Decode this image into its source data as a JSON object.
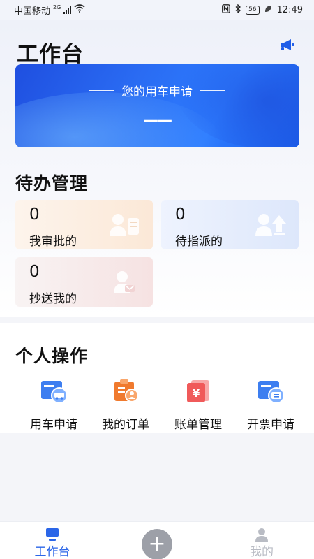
{
  "status_bar": {
    "carrier": "中国移动",
    "network": "2G",
    "battery": "56",
    "time": "12:49",
    "icons": [
      "signal-icon",
      "wifi-icon",
      "nfc-icon",
      "bluetooth-icon",
      "battery-icon",
      "leaf-icon"
    ]
  },
  "header": {
    "title": "工作台",
    "notice_icon": "megaphone-icon"
  },
  "banner": {
    "title": "您的用车申请",
    "value": "——"
  },
  "todo": {
    "title": "待办管理",
    "cards": [
      {
        "count": "0",
        "label": "我审批的",
        "icon": "approve-icon"
      },
      {
        "count": "0",
        "label": "待指派的",
        "icon": "assign-icon"
      },
      {
        "count": "0",
        "label": "抄送我的",
        "icon": "cc-icon"
      }
    ]
  },
  "personal": {
    "title": "个人操作",
    "items": [
      {
        "label": "用车申请",
        "icon": "car-request-icon",
        "color": "#3d7ef0"
      },
      {
        "label": "我的订单",
        "icon": "order-icon",
        "color": "#f07a2e"
      },
      {
        "label": "账单管理",
        "icon": "bill-icon",
        "color": "#f05a5a"
      },
      {
        "label": "开票申请",
        "icon": "invoice-icon",
        "color": "#3d7ef0"
      }
    ]
  },
  "bottom_nav": {
    "items": [
      {
        "label": "工作台",
        "active": true,
        "icon": "workbench-icon"
      },
      {
        "label": "",
        "icon": "plus-icon"
      },
      {
        "label": "我的",
        "active": false,
        "icon": "profile-icon"
      }
    ]
  },
  "colors": {
    "accent": "#2a6cf3",
    "nav_active": "#2b66e8",
    "nav_inactive": "#b9bcc4"
  }
}
